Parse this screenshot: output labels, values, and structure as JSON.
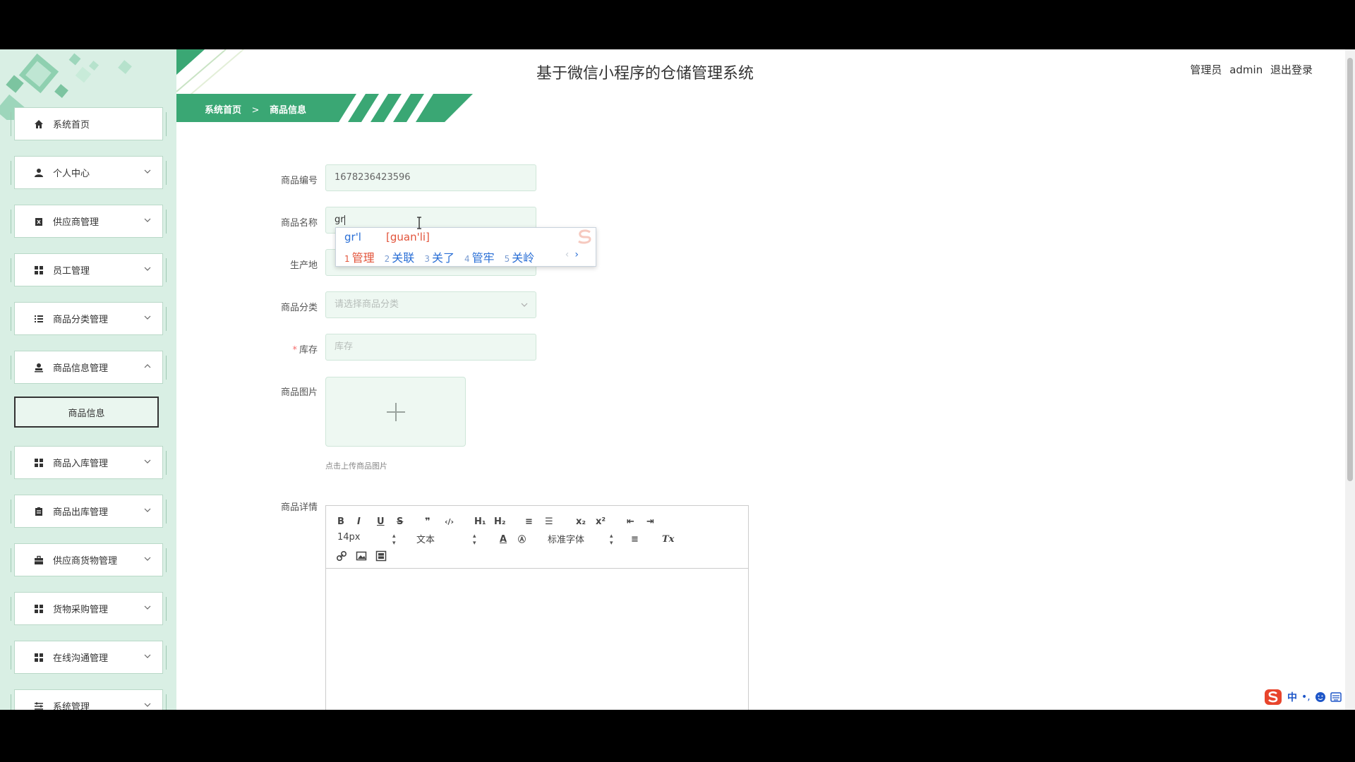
{
  "header": {
    "title": "基于微信小程序的仓储管理系统",
    "role": "管理员",
    "username": "admin",
    "logout": "退出登录"
  },
  "breadcrumb": {
    "home": "系统首页",
    "separator": ">",
    "current": "商品信息"
  },
  "sidebar": {
    "items": [
      {
        "label": "系统首页",
        "icon": "home-icon",
        "expandable": false
      },
      {
        "label": "个人中心",
        "icon": "user-icon",
        "expandable": true
      },
      {
        "label": "供应商管理",
        "icon": "clipboard-icon",
        "expandable": true
      },
      {
        "label": "员工管理",
        "icon": "grid-icon",
        "expandable": true
      },
      {
        "label": "商品分类管理",
        "icon": "list-icon",
        "expandable": true
      },
      {
        "label": "商品信息管理",
        "icon": "stamp-icon",
        "expandable": true,
        "expanded": true
      },
      {
        "label": "商品入库管理",
        "icon": "grid-icon",
        "expandable": true
      },
      {
        "label": "商品出库管理",
        "icon": "clipboard-icon",
        "expandable": true
      },
      {
        "label": "供应商货物管理",
        "icon": "briefcase-icon",
        "expandable": true
      },
      {
        "label": "货物采购管理",
        "icon": "grid-icon",
        "expandable": true
      },
      {
        "label": "在线沟通管理",
        "icon": "grid-icon",
        "expandable": true
      },
      {
        "label": "系统管理",
        "icon": "sliders-icon",
        "expandable": true
      }
    ],
    "active_subitem": "商品信息"
  },
  "form": {
    "code_label": "商品编号",
    "code_value": "1678236423596",
    "name_label": "商品名称",
    "name_value": "gr",
    "origin_label": "生产地",
    "category_label": "商品分类",
    "category_placeholder": "请选择商品分类",
    "stock_label": "库存",
    "stock_required_mark": "*",
    "stock_placeholder": "库存",
    "image_label": "商品图片",
    "image_hint": "点击上传商品图片",
    "detail_label": "商品详情"
  },
  "ime": {
    "typed": "gr'l",
    "pinyin": "[guan'li]",
    "candidates": [
      {
        "n": "1",
        "text": "管理"
      },
      {
        "n": "2",
        "text": "关联"
      },
      {
        "n": "3",
        "text": "关了"
      },
      {
        "n": "4",
        "text": "管牢"
      },
      {
        "n": "5",
        "text": "关岭"
      }
    ],
    "prev": "‹",
    "next": "›"
  },
  "editor": {
    "size_value": "14px",
    "block_value": "文本",
    "font_value": "标准字体",
    "toolbar": {
      "bold": "B",
      "italic": "I",
      "underline": "U",
      "strike": "S",
      "quote": "❞",
      "code": "‹/›",
      "h1": "H₁",
      "h2": "H₂",
      "ordered": "≡",
      "bullet": "☰",
      "sub": "x₂",
      "sup": "x²",
      "outdent": "⇤",
      "indent": "⇥",
      "color": "A",
      "bg": "Ⓐ",
      "align": "≡",
      "clean": "Tx"
    }
  },
  "tray": {
    "lang": "中"
  },
  "colors": {
    "accent": "#3aa774",
    "sidebar_bg": "#d9efe4",
    "input_bg": "#eef8f2",
    "ime_highlight": "#e2533a",
    "ime_text": "#2a6fd6"
  }
}
